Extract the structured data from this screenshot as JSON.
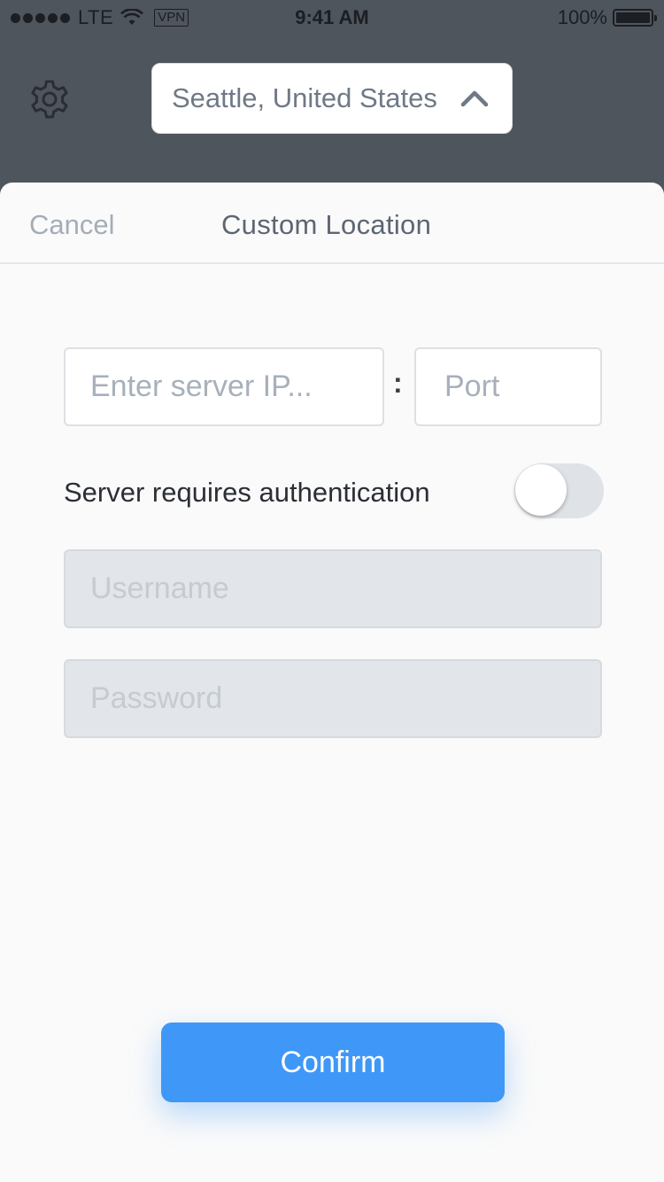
{
  "status_bar": {
    "carrier": "LTE",
    "vpn": "VPN",
    "time": "9:41 AM",
    "battery": "100%",
    "icons": [
      "signal-dots-icon",
      "wifi-icon",
      "battery-icon"
    ]
  },
  "header": {
    "settings_icon": "gear-icon",
    "location": "Seattle, United States",
    "location_chevron": "chevron-up-icon"
  },
  "sheet": {
    "cancel_label": "Cancel",
    "title": "Custom Location",
    "ip_placeholder": "Enter server IP...",
    "port_placeholder": "Port",
    "separator": ":",
    "auth_label": "Server requires authentication",
    "auth_enabled": false,
    "username_placeholder": "Username",
    "password_placeholder": "Password",
    "confirm_label": "Confirm"
  },
  "colors": {
    "header_bg": "#4f555d",
    "sheet_bg": "#fafafa",
    "accent": "#3f98f7"
  }
}
